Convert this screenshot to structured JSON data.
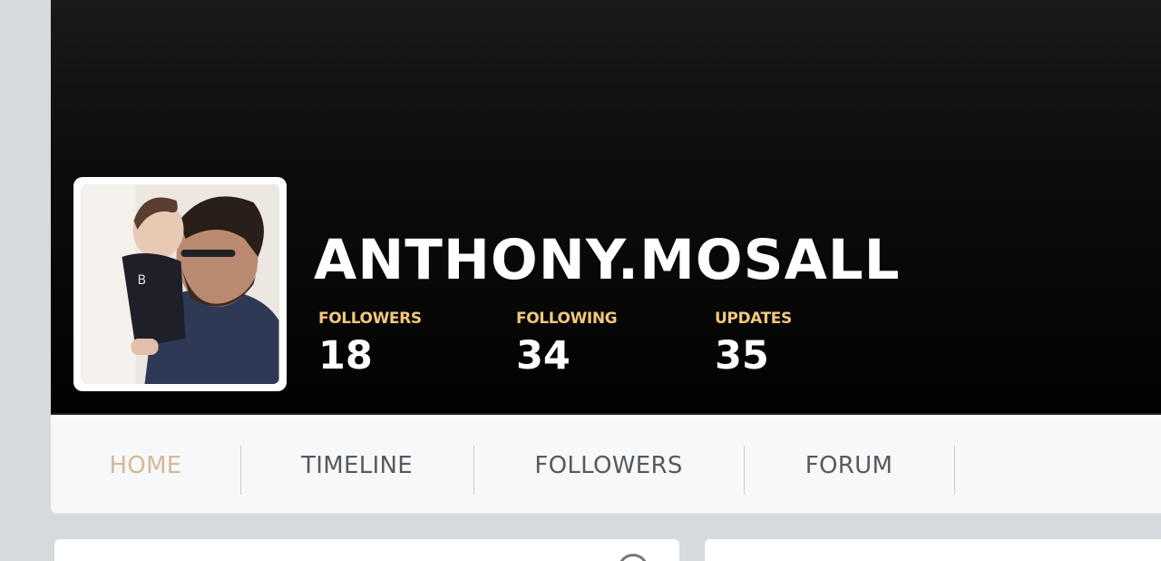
{
  "profile": {
    "username": "ANTHONY.MOSALL",
    "avatar_alt": "profile-photo"
  },
  "stats": [
    {
      "label": "FOLLOWERS",
      "value": "18"
    },
    {
      "label": "FOLLOWING",
      "value": "34"
    },
    {
      "label": "UPDATES",
      "value": "35"
    }
  ],
  "nav": {
    "items": [
      {
        "label": "HOME",
        "active": true
      },
      {
        "label": "TIMELINE",
        "active": false
      },
      {
        "label": "FOLLOWERS",
        "active": false
      },
      {
        "label": "FORUM",
        "active": false
      }
    ]
  },
  "colors": {
    "accent_stat_label": "#f0c77c",
    "nav_active": "#d5b896",
    "nav_text": "#555a5e",
    "cover": "#000000",
    "page_bg": "#d6d9dd"
  },
  "icons": {
    "panel_corner": "circle-icon"
  }
}
